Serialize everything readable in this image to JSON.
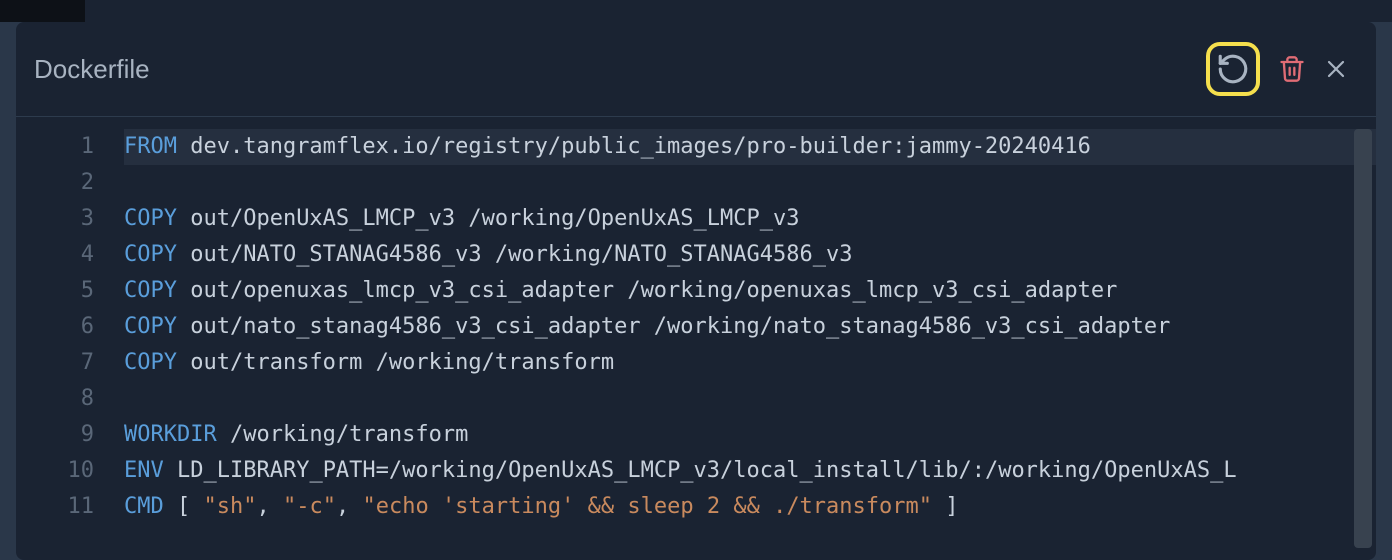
{
  "panel": {
    "title": "Dockerfile"
  },
  "code": {
    "lines": [
      {
        "num": "1",
        "current": true,
        "tokens": [
          {
            "cls": "tok-keyword",
            "t": "FROM"
          },
          {
            "cls": "tok-text",
            "t": " dev.tangramflex.io/registry/public_images/pro-builder:jammy-20240416"
          }
        ]
      },
      {
        "num": "2",
        "current": false,
        "tokens": []
      },
      {
        "num": "3",
        "current": false,
        "tokens": [
          {
            "cls": "tok-keyword",
            "t": "COPY"
          },
          {
            "cls": "tok-text",
            "t": " out/OpenUxAS_LMCP_v3 /working/OpenUxAS_LMCP_v3"
          }
        ]
      },
      {
        "num": "4",
        "current": false,
        "tokens": [
          {
            "cls": "tok-keyword",
            "t": "COPY"
          },
          {
            "cls": "tok-text",
            "t": " out/NATO_STANAG4586_v3 /working/NATO_STANAG4586_v3"
          }
        ]
      },
      {
        "num": "5",
        "current": false,
        "tokens": [
          {
            "cls": "tok-keyword",
            "t": "COPY"
          },
          {
            "cls": "tok-text",
            "t": " out/openuxas_lmcp_v3_csi_adapter /working/openuxas_lmcp_v3_csi_adapter"
          }
        ]
      },
      {
        "num": "6",
        "current": false,
        "tokens": [
          {
            "cls": "tok-keyword",
            "t": "COPY"
          },
          {
            "cls": "tok-text",
            "t": " out/nato_stanag4586_v3_csi_adapter /working/nato_stanag4586_v3_csi_adapter"
          }
        ]
      },
      {
        "num": "7",
        "current": false,
        "tokens": [
          {
            "cls": "tok-keyword",
            "t": "COPY"
          },
          {
            "cls": "tok-text",
            "t": " out/transform /working/transform"
          }
        ]
      },
      {
        "num": "8",
        "current": false,
        "tokens": []
      },
      {
        "num": "9",
        "current": false,
        "tokens": [
          {
            "cls": "tok-keyword",
            "t": "WORKDIR"
          },
          {
            "cls": "tok-text",
            "t": " /working/transform"
          }
        ]
      },
      {
        "num": "10",
        "current": false,
        "tokens": [
          {
            "cls": "tok-keyword",
            "t": "ENV"
          },
          {
            "cls": "tok-text",
            "t": " LD_LIBRARY_PATH=/working/OpenUxAS_LMCP_v3/local_install/lib/:/working/OpenUxAS_L"
          }
        ]
      },
      {
        "num": "11",
        "current": false,
        "tokens": [
          {
            "cls": "tok-keyword",
            "t": "CMD"
          },
          {
            "cls": "tok-punc",
            "t": " [ "
          },
          {
            "cls": "tok-string",
            "t": "\"sh\""
          },
          {
            "cls": "tok-punc",
            "t": ", "
          },
          {
            "cls": "tok-string",
            "t": "\"-c\""
          },
          {
            "cls": "tok-punc",
            "t": ", "
          },
          {
            "cls": "tok-string",
            "t": "\"echo 'starting' && sleep 2 && ./transform\""
          },
          {
            "cls": "tok-punc",
            "t": " ]"
          }
        ]
      }
    ]
  }
}
